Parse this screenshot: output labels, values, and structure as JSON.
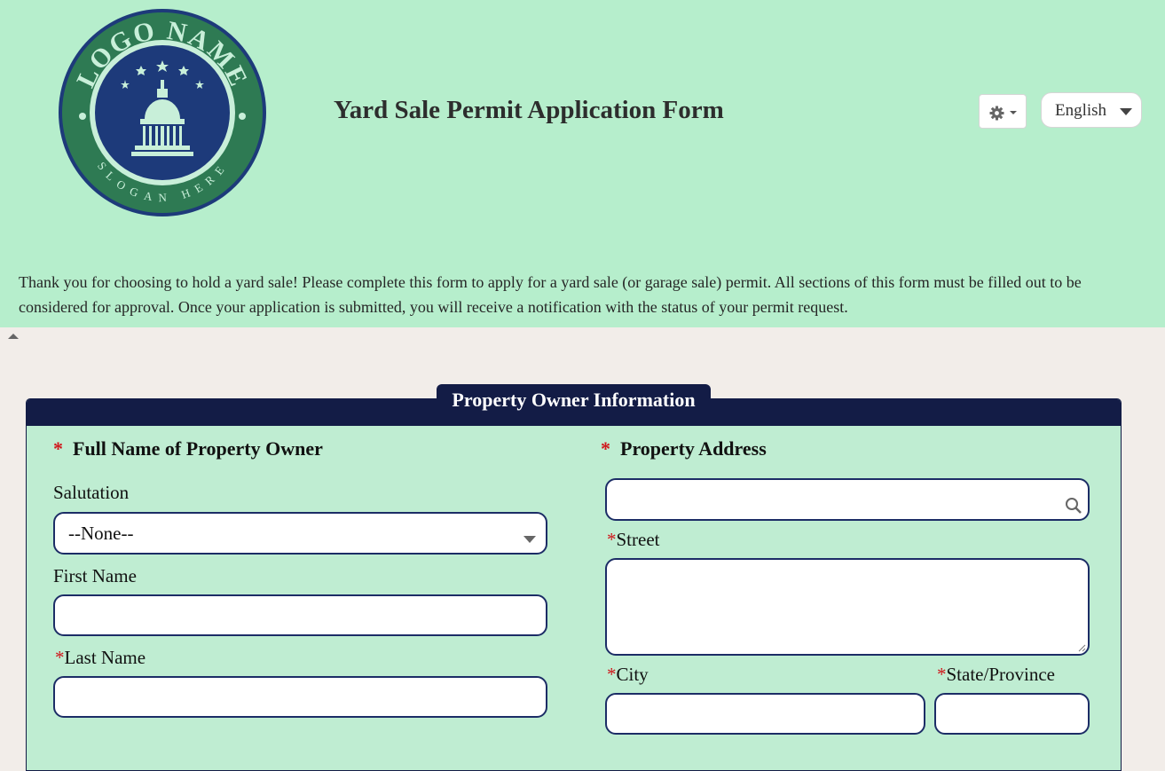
{
  "header": {
    "logo": {
      "top_text": "LOGO NAME",
      "bottom_text": "SLOGAN HERE"
    },
    "title": "Yard Sale Permit Application Form",
    "settings_icon": "gear-icon",
    "language": {
      "selected": "English"
    },
    "intro": "Thank you for choosing to hold a yard sale! Please complete this form to apply for a yard sale (or garage sale) permit. All sections of this form must be filled out to be considered for approval. Once your application is submitted, you will receive a notification with the status of your permit request."
  },
  "section": {
    "title": "Property Owner Information",
    "required_mark": "*",
    "owner": {
      "heading": "Full Name of Property Owner",
      "salutation_label": "Salutation",
      "salutation_value": "--None--",
      "first_name_label": "First Name",
      "first_name_value": "",
      "last_name_label": "Last Name",
      "last_name_value": ""
    },
    "address": {
      "heading": "Property Address",
      "search_value": "",
      "street_label": "Street",
      "street_value": "",
      "city_label": "City",
      "city_value": "",
      "state_label": "State/Province",
      "state_value": ""
    }
  },
  "colors": {
    "header_bg": "#b6eecc",
    "page_bg": "#f2ede9",
    "section_bg": "#bfedd2",
    "navy": "#131c46",
    "required": "#d0161b",
    "input_border": "#1c2d66"
  }
}
